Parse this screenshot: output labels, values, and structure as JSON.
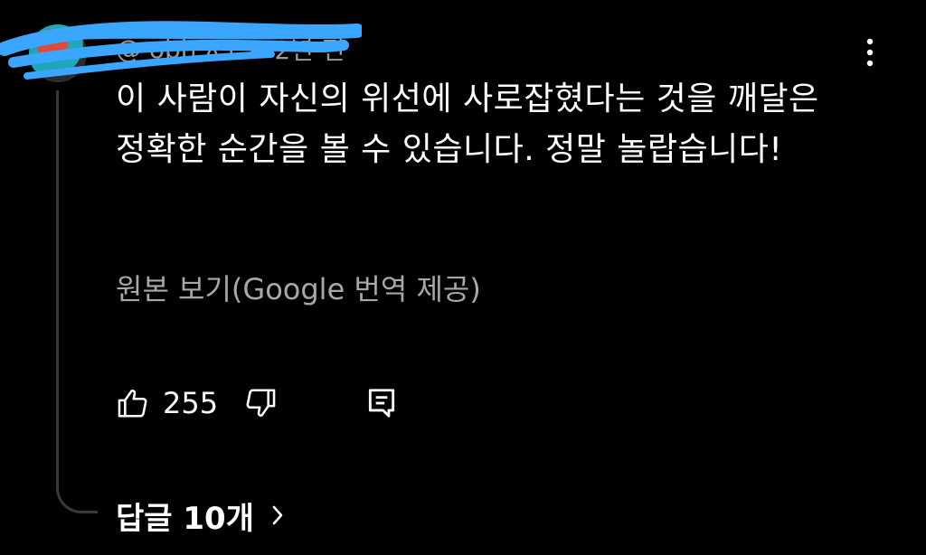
{
  "comment": {
    "author_handle": "@·obh·ʌ·ʟ·ʜ",
    "timestamp": "2년 전",
    "text": "이 사람이 자신의 위선에 사로잡혔다는 것을 깨달은 정확한 순간을 볼 수 있습니다. 정말 놀랍습니다!",
    "translation_link": "원본 보기(Google 번역 제공)",
    "like_count": "255",
    "replies_label": "답글 10개"
  },
  "icons": {
    "avatar": "avatar-image",
    "more": "more-vert-icon",
    "like": "thumbs-up-icon",
    "dislike": "thumbs-down-icon",
    "reply": "reply-comment-icon",
    "chevron": "chevron-right-icon"
  },
  "colors": {
    "background": "#000000",
    "text": "#ffffff",
    "secondary_text": "#a8a8a8",
    "scribble": "#3aa6ff"
  }
}
